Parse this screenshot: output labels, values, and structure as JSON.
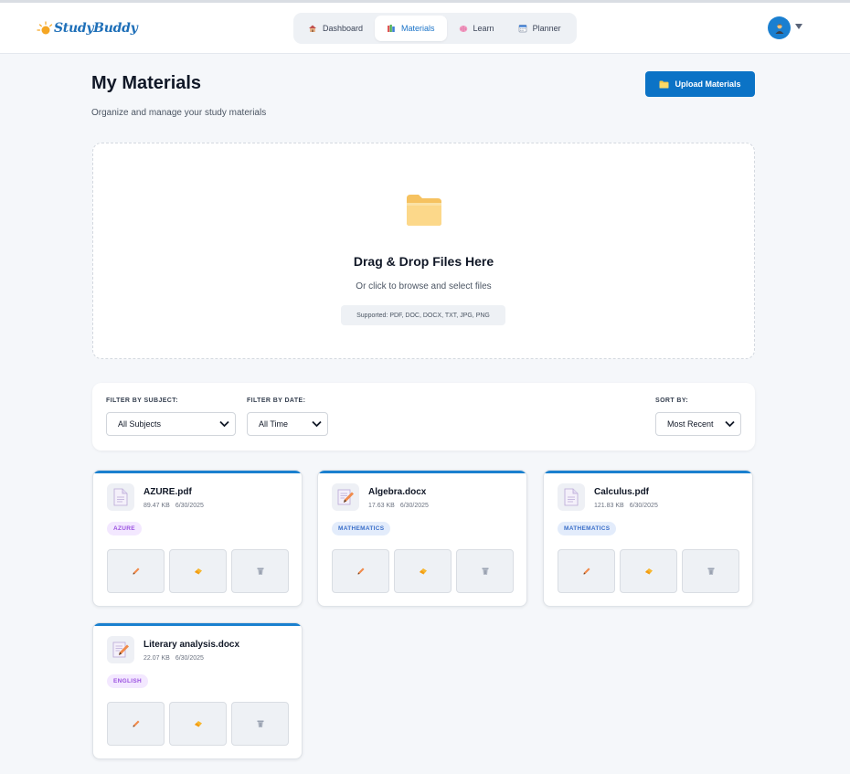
{
  "app": {
    "logo_text": "StudyBuddy",
    "brand_color": "#1e6fb8",
    "accent_color": "#0b73c6"
  },
  "nav": {
    "items": [
      {
        "label": "Dashboard",
        "icon": "house-icon",
        "active": false
      },
      {
        "label": "Materials",
        "icon": "books-icon",
        "active": true
      },
      {
        "label": "Learn",
        "icon": "brain-icon",
        "active": false
      },
      {
        "label": "Planner",
        "icon": "calendar-icon",
        "active": false
      }
    ]
  },
  "user": {
    "avatar_icon": "user-avatar-icon"
  },
  "page": {
    "title": "My Materials",
    "subtitle": "Organize and manage your study materials",
    "upload_label": "Upload Materials"
  },
  "dropzone": {
    "icon": "folder-icon",
    "title": "Drag & Drop Files Here",
    "subtitle": "Or click to browse and select files",
    "supported": "Supported: PDF, DOC, DOCX, TXT, JPG, PNG"
  },
  "filters": {
    "subject": {
      "label": "FILTER BY SUBJECT:",
      "value": "All Subjects"
    },
    "date": {
      "label": "FILTER BY DATE:",
      "value": "All Time"
    },
    "sort": {
      "label": "SORT BY:",
      "value": "Most Recent"
    }
  },
  "materials": [
    {
      "name": "AZURE.pdf",
      "size": "89.47 KB",
      "date": "6/30/2025",
      "tag": "AZURE",
      "tag_color": "purple",
      "icon": "document-icon"
    },
    {
      "name": "Algebra.docx",
      "size": "17.63 KB",
      "date": "6/30/2025",
      "tag": "MATHEMATICS",
      "tag_color": "blue",
      "icon": "memo-icon"
    },
    {
      "name": "Calculus.pdf",
      "size": "121.83 KB",
      "date": "6/30/2025",
      "tag": "MATHEMATICS",
      "tag_color": "blue",
      "icon": "document-icon"
    },
    {
      "name": "Literary analysis.docx",
      "size": "22.07 KB",
      "date": "6/30/2025",
      "tag": "ENGLISH",
      "tag_color": "purple",
      "icon": "memo-icon"
    }
  ],
  "card_actions": [
    {
      "icon": "pencil-icon"
    },
    {
      "icon": "eraser-icon"
    },
    {
      "icon": "trash-icon"
    }
  ]
}
